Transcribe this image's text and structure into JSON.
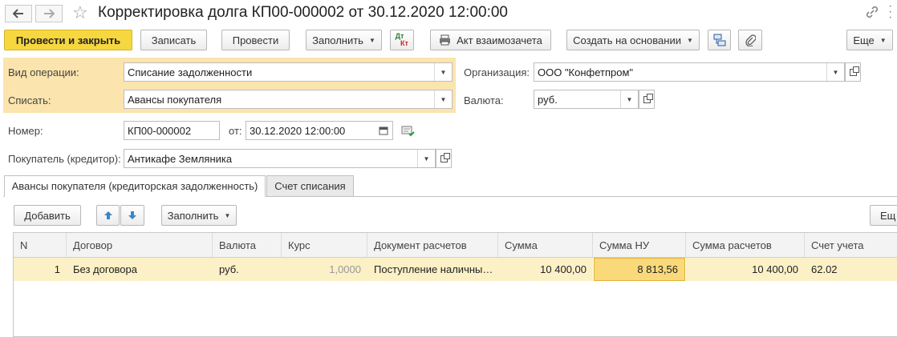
{
  "window": {
    "title": "Корректировка долга КП00-000002 от 30.12.2020 12:00:00",
    "back_icon": "arrow-left-icon",
    "forward_icon": "arrow-right-icon",
    "favorite_icon": "star-icon",
    "link_icon": "link-icon",
    "more_icon": "vertical-dots-icon",
    "close_icon": "close-icon"
  },
  "toolbar": {
    "post_close": "Провести и закрыть",
    "save": "Записать",
    "post": "Провести",
    "fill": "Заполнить",
    "dt_kt_top": "Дт",
    "dt_kt_bottom": "Кт",
    "act": "Акт взаимозачета",
    "create_based": "Создать на основании",
    "more": "Еще"
  },
  "form": {
    "operation_label": "Вид операции:",
    "operation_value": "Списание задолженности",
    "writeoff_label": "Списать:",
    "writeoff_value": "Авансы покупателя",
    "org_label": "Организация:",
    "org_value": "ООО \"Конфетпром\"",
    "currency_label": "Валюта:",
    "currency_value": "руб.",
    "number_label": "Номер:",
    "number_value": "КП00-000002",
    "date_label": "от:",
    "date_value": "30.12.2020 12:00:00",
    "buyer_label": "Покупатель (кредитор):",
    "buyer_value": "Антикафе Земляника"
  },
  "tabs": [
    {
      "label": "Авансы покупателя (кредиторская задолженность)",
      "active": true
    },
    {
      "label": "Счет списания",
      "active": false
    }
  ],
  "table_toolbar": {
    "add": "Добавить",
    "fill": "Заполнить",
    "more": "Ещ"
  },
  "table": {
    "columns": [
      "N",
      "Договор",
      "Валюта",
      "Курс",
      "Документ расчетов",
      "Сумма",
      "Сумма НУ",
      "Сумма расчетов",
      "Счет учета"
    ],
    "rows": [
      [
        "1",
        "Без договора",
        "руб.",
        "1,0000",
        "Поступление наличны…",
        "10 400,00",
        "8 813,56",
        "10 400,00",
        "62.02"
      ]
    ]
  },
  "colors": {
    "primary_button": "#f7d73f",
    "highlight_area": "#fbe4ad",
    "row_highlight": "#fbf0c6",
    "selected_cell": "#f9d97a"
  }
}
